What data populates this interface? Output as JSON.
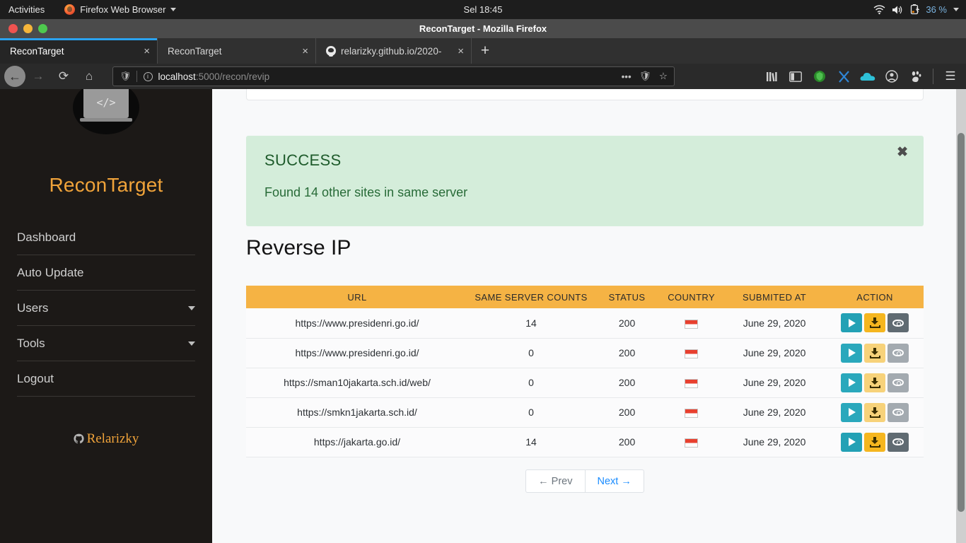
{
  "gnome": {
    "activities": "Activities",
    "app_menu": "Firefox Web Browser",
    "clock": "Sel 18:45",
    "battery_percent": "36 %",
    "icons": [
      "wifi-icon",
      "volume-icon",
      "battery-icon",
      "chevron-down-icon"
    ]
  },
  "window": {
    "title": "ReconTarget - Mozilla Firefox",
    "buttons": [
      "close",
      "minimize",
      "maximize"
    ],
    "button_colors": [
      "#ef5350",
      "#f5b53a",
      "#4ec94e"
    ]
  },
  "tabs": [
    {
      "label": "ReconTarget",
      "active": true,
      "close": "×",
      "favicon": "none"
    },
    {
      "label": "ReconTarget",
      "active": false,
      "close": "×",
      "favicon": "none"
    },
    {
      "label": "relarizky.github.io/2020-",
      "active": false,
      "close": "×",
      "favicon": "github-icon"
    }
  ],
  "newtab_label": "+",
  "toolbar": {
    "back": "←",
    "forward": "→",
    "reload": "⟳",
    "home": "⌂",
    "url_host": "localhost",
    "url_path": ":5000/recon/revip",
    "more_label": "•••",
    "extensions": [
      "library-icon",
      "sidebar-icon",
      "shield-extension-icon",
      "x-extension-icon",
      "cloud-icon",
      "account-icon",
      "gnome-extension-icon"
    ],
    "menu_label": "☰"
  },
  "sidebar": {
    "brand": "ReconTarget",
    "logo_text": "</>",
    "items": [
      {
        "label": "Dashboard",
        "has_caret": false
      },
      {
        "label": "Auto Update",
        "has_caret": false
      },
      {
        "label": "Users",
        "has_caret": true
      },
      {
        "label": "Tools",
        "has_caret": true
      },
      {
        "label": "Logout",
        "has_caret": false
      }
    ],
    "author": "Relarizky",
    "accent_color": "#f0a33a",
    "background_color": "#1c1917"
  },
  "alert": {
    "title": "SUCCESS",
    "message": "Found 14 other sites in same server",
    "close": "✖",
    "background_color": "#d4edda",
    "text_color": "#286b38"
  },
  "main": {
    "page_title": "Reverse IP",
    "table": {
      "header_color": "#f5b344",
      "columns": [
        "URL",
        "SAME SERVER COUNTS",
        "STATUS",
        "COUNTRY",
        "SUBMITED AT",
        "ACTION"
      ],
      "rows": [
        {
          "url": "https://www.presidenri.go.id/",
          "same_server_counts": "14",
          "status": "200",
          "country": "indonesia-flag-icon",
          "submited_at": "June 29, 2020",
          "actions_enabled": true
        },
        {
          "url": "https://www.presidenri.go.id/",
          "same_server_counts": "0",
          "status": "200",
          "country": "indonesia-flag-icon",
          "submited_at": "June 29, 2020",
          "actions_enabled": false
        },
        {
          "url": "https://sman10jakarta.sch.id/web/",
          "same_server_counts": "0",
          "status": "200",
          "country": "indonesia-flag-icon",
          "submited_at": "June 29, 2020",
          "actions_enabled": false
        },
        {
          "url": "https://smkn1jakarta.sch.id/",
          "same_server_counts": "0",
          "status": "200",
          "country": "indonesia-flag-icon",
          "submited_at": "June 29, 2020",
          "actions_enabled": false
        },
        {
          "url": "https://jakarta.go.id/",
          "same_server_counts": "14",
          "status": "200",
          "country": "indonesia-flag-icon",
          "submited_at": "June 29, 2020",
          "actions_enabled": true
        }
      ],
      "action_icons": [
        "play-icon",
        "download-icon",
        "eye-icon"
      ]
    },
    "pagination": {
      "prev": "← Prev",
      "next": "Next →"
    }
  }
}
